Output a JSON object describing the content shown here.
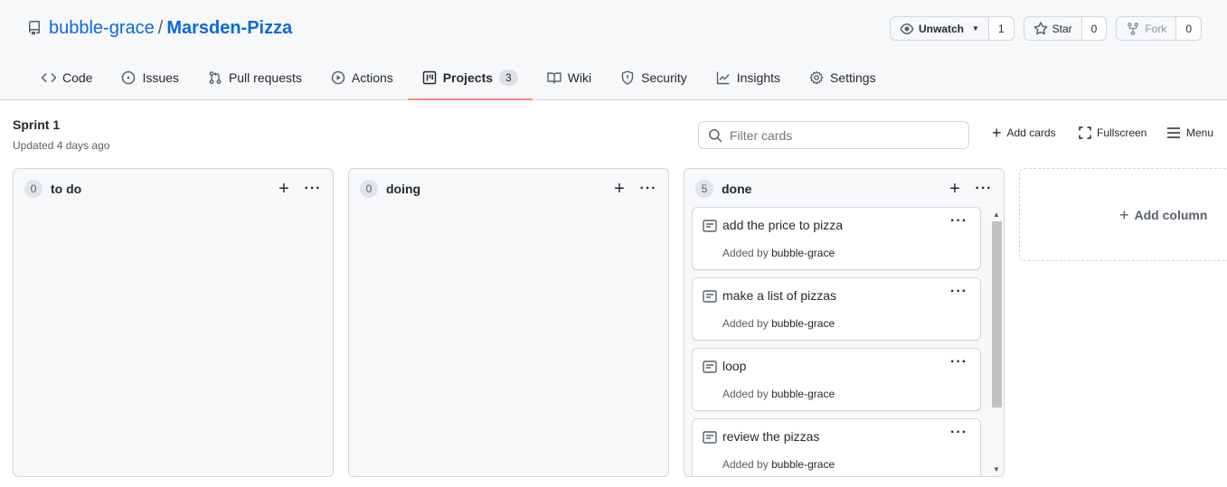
{
  "repo": {
    "owner": "bubble-grace",
    "separator": "/",
    "name": "Marsden-Pizza"
  },
  "actions": {
    "watch": {
      "label": "Unwatch",
      "count": "1"
    },
    "star": {
      "label": "Star",
      "count": "0"
    },
    "fork": {
      "label": "Fork",
      "count": "0"
    }
  },
  "tabs": [
    {
      "label": "Code",
      "icon": "code-icon"
    },
    {
      "label": "Issues",
      "icon": "issue-icon"
    },
    {
      "label": "Pull requests",
      "icon": "pull-request-icon"
    },
    {
      "label": "Actions",
      "icon": "play-icon"
    },
    {
      "label": "Projects",
      "icon": "project-icon",
      "count": "3",
      "active": true
    },
    {
      "label": "Wiki",
      "icon": "book-icon"
    },
    {
      "label": "Security",
      "icon": "shield-icon"
    },
    {
      "label": "Insights",
      "icon": "graph-icon"
    },
    {
      "label": "Settings",
      "icon": "gear-icon"
    }
  ],
  "board": {
    "title": "Sprint 1",
    "updated": "Updated 4 days ago",
    "filter_placeholder": "Filter cards",
    "add_cards": "Add cards",
    "fullscreen": "Fullscreen",
    "menu": "Menu",
    "add_column": "Add column"
  },
  "columns": [
    {
      "name": "to do",
      "count": "0",
      "cards": []
    },
    {
      "name": "doing",
      "count": "0",
      "cards": []
    },
    {
      "name": "done",
      "count": "5",
      "cards": [
        {
          "title": "add the price to pizza",
          "added_by_prefix": "Added by",
          "author": "bubble-grace"
        },
        {
          "title": "make a list of pizzas",
          "added_by_prefix": "Added by",
          "author": "bubble-grace"
        },
        {
          "title": "loop",
          "added_by_prefix": "Added by",
          "author": "bubble-grace"
        },
        {
          "title": "review the pizzas",
          "added_by_prefix": "Added by",
          "author": "bubble-grace"
        }
      ]
    }
  ],
  "colors": {
    "link": "#0969da",
    "tab_underline": "#fd8c73",
    "column_bg": "#f6f8fa",
    "border": "#d0d7de"
  }
}
